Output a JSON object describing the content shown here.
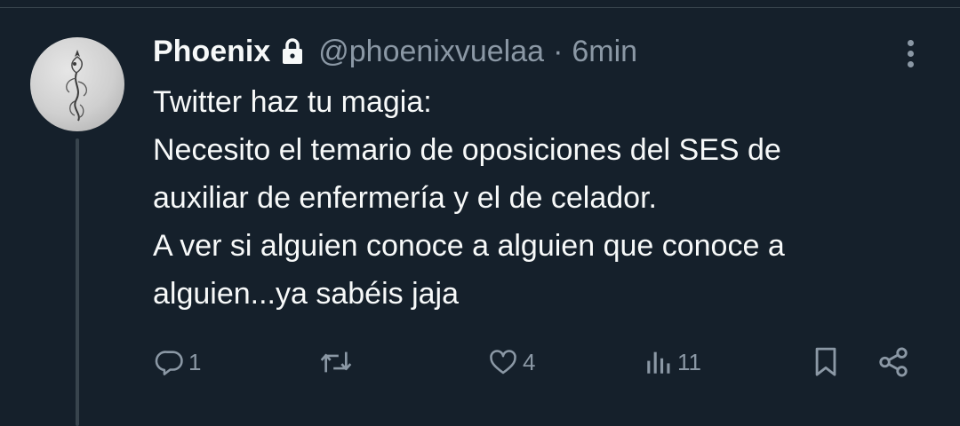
{
  "tweet": {
    "display_name": "Phoenix",
    "handle": "@phoenixvuelaa",
    "separator": "·",
    "time": "6min",
    "lines": [
      "Twitter haz tu magia:",
      "Necesito el temario de oposiciones del SES de",
      "auxiliar de enfermería y el de celador.",
      "A ver si alguien conoce a alguien que conoce a",
      "alguien...ya sabéis jaja"
    ]
  },
  "actions": {
    "reply_count": "1",
    "retweet_count": "",
    "like_count": "4",
    "views_count": "11"
  },
  "icons": {
    "lock": "lock-icon",
    "more": "more-vertical-icon",
    "reply": "reply-icon",
    "retweet": "retweet-icon",
    "like": "heart-icon",
    "views": "views-icon",
    "bookmark": "bookmark-icon",
    "share": "share-icon"
  },
  "colors": {
    "background": "#15202b",
    "text": "#f7f9f9",
    "secondary": "#8b98a5",
    "divider": "#38444d"
  }
}
